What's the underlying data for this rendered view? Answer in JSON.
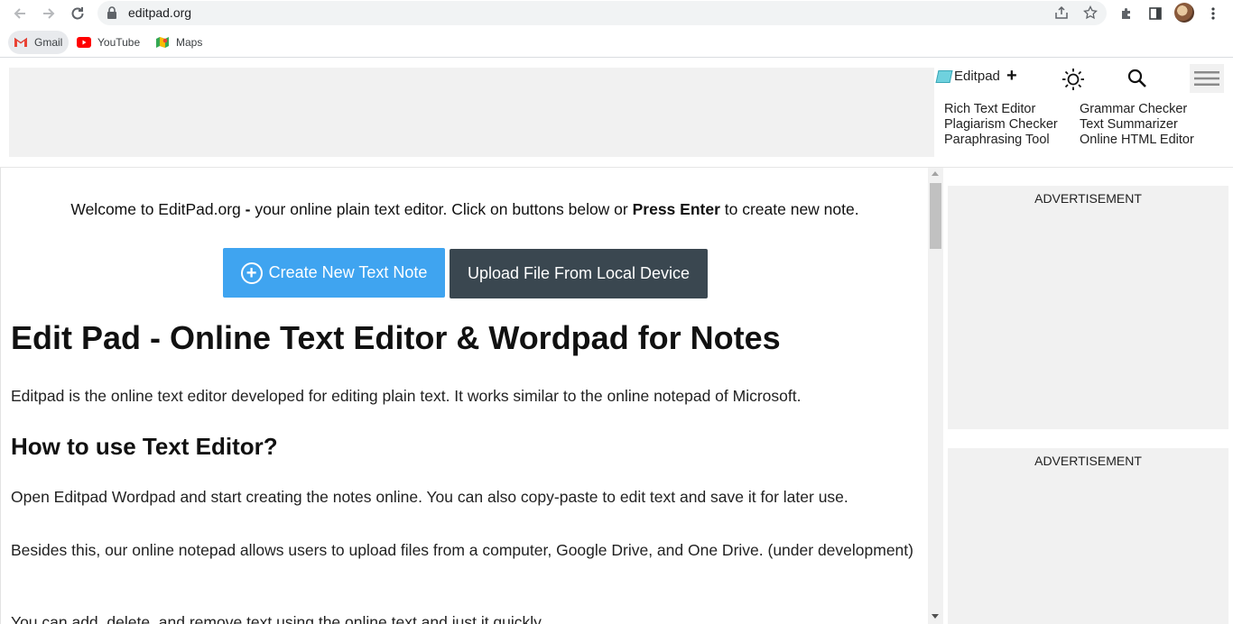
{
  "browser": {
    "url": "editpad.org",
    "bookmarks": [
      {
        "label": "Gmail",
        "icon": "gmail-icon"
      },
      {
        "label": "YouTube",
        "icon": "youtube-icon"
      },
      {
        "label": "Maps",
        "icon": "maps-icon"
      }
    ]
  },
  "header": {
    "brand": "Editpad",
    "plus": "+",
    "tools_left": [
      "Rich Text Editor",
      "Plagiarism Checker",
      "Paraphrasing Tool"
    ],
    "tools_right": [
      "Grammar Checker",
      "Text Summarizer",
      "Online HTML Editor"
    ]
  },
  "main": {
    "welcome_pre": "Welcome to EditPad.org ",
    "welcome_dash": "-",
    "welcome_mid": " your online plain text editor. Click on buttons below or ",
    "welcome_bold": "Press Enter",
    "welcome_post": " to create new note.",
    "create_button": "Create New Text Note",
    "upload_button": "Upload File From Local Device",
    "title": "Edit Pad - Online Text Editor & Wordpad for Notes",
    "intro": "Editpad is the online text editor developed for editing plain text. It works similar to the online notepad of Microsoft.",
    "howto_heading": "How to use Text Editor?",
    "howto_p1": "Open Editpad Wordpad and start creating the notes online. You can also copy-paste to edit text and save it for later use.",
    "howto_p2": "Besides this, our online notepad allows users to upload files from a computer, Google Drive, and One Drive. (under development)",
    "howto_p3": "You can add, delete, and remove text using the online text and just it quickly."
  },
  "sidebar": {
    "ad1": "ADVERTISEMENT",
    "ad2": "ADVERTISEMENT"
  },
  "colors": {
    "create_button": "#3fa4f0",
    "upload_button": "#3a4750",
    "ad_background": "#f1f1f1"
  }
}
